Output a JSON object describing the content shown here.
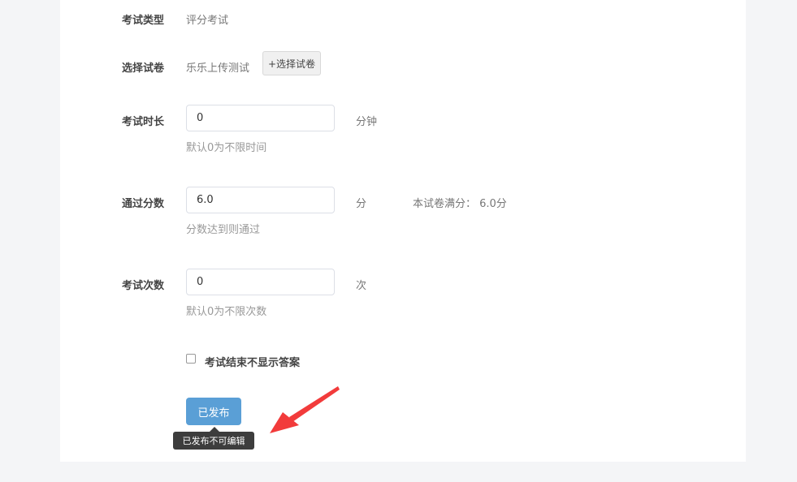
{
  "form": {
    "exam_type": {
      "label": "考试类型",
      "value": "评分考试"
    },
    "exam_paper": {
      "label": "选择试卷",
      "value": "乐乐上传测试",
      "select_button": "+选择试卷"
    },
    "duration": {
      "label": "考试时长",
      "value": "0",
      "unit": "分钟",
      "help": "默认0为不限时间"
    },
    "pass_score": {
      "label": "通过分数",
      "value": "6.0",
      "unit": "分",
      "full_score_note": "本试卷满分： 6.0分",
      "help": "分数达到则通过"
    },
    "attempts": {
      "label": "考试次数",
      "value": "0",
      "unit": "次",
      "help": "默认0为不限次数"
    },
    "hide_answers": {
      "label": "考试结束不显示答案",
      "checked": false
    },
    "publish_button": "已发布",
    "tooltip": "已发布不可编辑"
  },
  "colors": {
    "primary": "#5a9fd6",
    "annotation_arrow": "#f23b3b",
    "tooltip_bg": "#3d3d3d"
  }
}
